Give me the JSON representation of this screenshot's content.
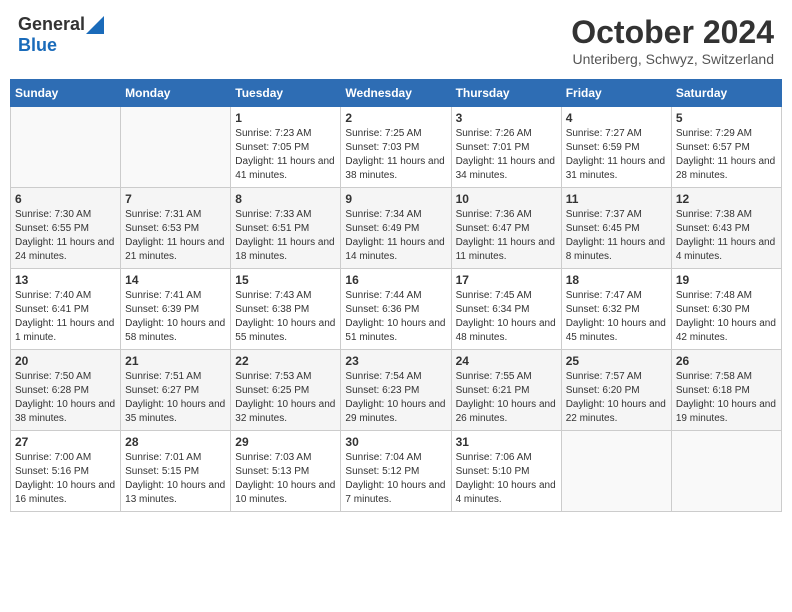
{
  "header": {
    "logo_general": "General",
    "logo_blue": "Blue",
    "month_title": "October 2024",
    "location": "Unteriberg, Schwyz, Switzerland"
  },
  "days_of_week": [
    "Sunday",
    "Monday",
    "Tuesday",
    "Wednesday",
    "Thursday",
    "Friday",
    "Saturday"
  ],
  "weeks": [
    [
      {
        "day": "",
        "info": ""
      },
      {
        "day": "",
        "info": ""
      },
      {
        "day": "1",
        "info": "Sunrise: 7:23 AM\nSunset: 7:05 PM\nDaylight: 11 hours and 41 minutes."
      },
      {
        "day": "2",
        "info": "Sunrise: 7:25 AM\nSunset: 7:03 PM\nDaylight: 11 hours and 38 minutes."
      },
      {
        "day": "3",
        "info": "Sunrise: 7:26 AM\nSunset: 7:01 PM\nDaylight: 11 hours and 34 minutes."
      },
      {
        "day": "4",
        "info": "Sunrise: 7:27 AM\nSunset: 6:59 PM\nDaylight: 11 hours and 31 minutes."
      },
      {
        "day": "5",
        "info": "Sunrise: 7:29 AM\nSunset: 6:57 PM\nDaylight: 11 hours and 28 minutes."
      }
    ],
    [
      {
        "day": "6",
        "info": "Sunrise: 7:30 AM\nSunset: 6:55 PM\nDaylight: 11 hours and 24 minutes."
      },
      {
        "day": "7",
        "info": "Sunrise: 7:31 AM\nSunset: 6:53 PM\nDaylight: 11 hours and 21 minutes."
      },
      {
        "day": "8",
        "info": "Sunrise: 7:33 AM\nSunset: 6:51 PM\nDaylight: 11 hours and 18 minutes."
      },
      {
        "day": "9",
        "info": "Sunrise: 7:34 AM\nSunset: 6:49 PM\nDaylight: 11 hours and 14 minutes."
      },
      {
        "day": "10",
        "info": "Sunrise: 7:36 AM\nSunset: 6:47 PM\nDaylight: 11 hours and 11 minutes."
      },
      {
        "day": "11",
        "info": "Sunrise: 7:37 AM\nSunset: 6:45 PM\nDaylight: 11 hours and 8 minutes."
      },
      {
        "day": "12",
        "info": "Sunrise: 7:38 AM\nSunset: 6:43 PM\nDaylight: 11 hours and 4 minutes."
      }
    ],
    [
      {
        "day": "13",
        "info": "Sunrise: 7:40 AM\nSunset: 6:41 PM\nDaylight: 11 hours and 1 minute."
      },
      {
        "day": "14",
        "info": "Sunrise: 7:41 AM\nSunset: 6:39 PM\nDaylight: 10 hours and 58 minutes."
      },
      {
        "day": "15",
        "info": "Sunrise: 7:43 AM\nSunset: 6:38 PM\nDaylight: 10 hours and 55 minutes."
      },
      {
        "day": "16",
        "info": "Sunrise: 7:44 AM\nSunset: 6:36 PM\nDaylight: 10 hours and 51 minutes."
      },
      {
        "day": "17",
        "info": "Sunrise: 7:45 AM\nSunset: 6:34 PM\nDaylight: 10 hours and 48 minutes."
      },
      {
        "day": "18",
        "info": "Sunrise: 7:47 AM\nSunset: 6:32 PM\nDaylight: 10 hours and 45 minutes."
      },
      {
        "day": "19",
        "info": "Sunrise: 7:48 AM\nSunset: 6:30 PM\nDaylight: 10 hours and 42 minutes."
      }
    ],
    [
      {
        "day": "20",
        "info": "Sunrise: 7:50 AM\nSunset: 6:28 PM\nDaylight: 10 hours and 38 minutes."
      },
      {
        "day": "21",
        "info": "Sunrise: 7:51 AM\nSunset: 6:27 PM\nDaylight: 10 hours and 35 minutes."
      },
      {
        "day": "22",
        "info": "Sunrise: 7:53 AM\nSunset: 6:25 PM\nDaylight: 10 hours and 32 minutes."
      },
      {
        "day": "23",
        "info": "Sunrise: 7:54 AM\nSunset: 6:23 PM\nDaylight: 10 hours and 29 minutes."
      },
      {
        "day": "24",
        "info": "Sunrise: 7:55 AM\nSunset: 6:21 PM\nDaylight: 10 hours and 26 minutes."
      },
      {
        "day": "25",
        "info": "Sunrise: 7:57 AM\nSunset: 6:20 PM\nDaylight: 10 hours and 22 minutes."
      },
      {
        "day": "26",
        "info": "Sunrise: 7:58 AM\nSunset: 6:18 PM\nDaylight: 10 hours and 19 minutes."
      }
    ],
    [
      {
        "day": "27",
        "info": "Sunrise: 7:00 AM\nSunset: 5:16 PM\nDaylight: 10 hours and 16 minutes."
      },
      {
        "day": "28",
        "info": "Sunrise: 7:01 AM\nSunset: 5:15 PM\nDaylight: 10 hours and 13 minutes."
      },
      {
        "day": "29",
        "info": "Sunrise: 7:03 AM\nSunset: 5:13 PM\nDaylight: 10 hours and 10 minutes."
      },
      {
        "day": "30",
        "info": "Sunrise: 7:04 AM\nSunset: 5:12 PM\nDaylight: 10 hours and 7 minutes."
      },
      {
        "day": "31",
        "info": "Sunrise: 7:06 AM\nSunset: 5:10 PM\nDaylight: 10 hours and 4 minutes."
      },
      {
        "day": "",
        "info": ""
      },
      {
        "day": "",
        "info": ""
      }
    ]
  ]
}
